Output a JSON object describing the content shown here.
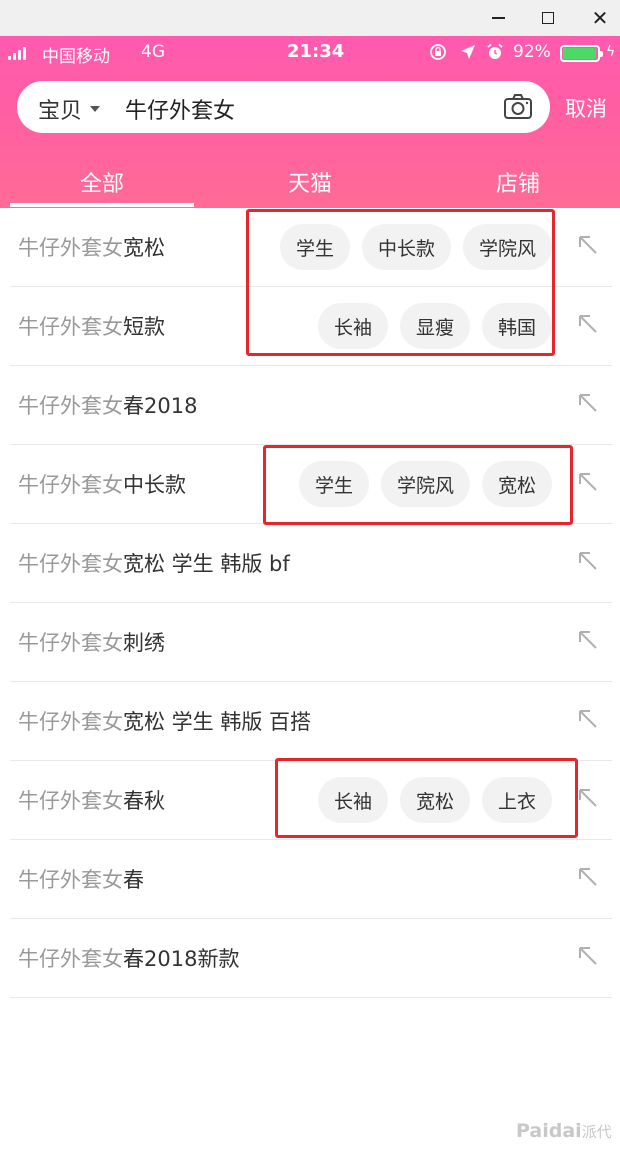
{
  "window": {
    "minimize": "minimize",
    "maximize": "maximize",
    "close": "close"
  },
  "status": {
    "carrier": "中国移动",
    "network": "4G",
    "time": "21:34",
    "battery": "92%",
    "battery_level": 0.92
  },
  "search": {
    "scope": "宝贝",
    "query": "牛仔外套女",
    "cancel": "取消"
  },
  "tabs": [
    {
      "label": "全部",
      "active": true
    },
    {
      "label": "天猫",
      "active": false
    },
    {
      "label": "店铺",
      "active": false
    }
  ],
  "suggestions": [
    {
      "base": "牛仔外套女",
      "suffix": "宽松",
      "tags": [
        "学生",
        "中长款",
        "学院风"
      ]
    },
    {
      "base": "牛仔外套女",
      "suffix": "短款",
      "tags": [
        "长袖",
        "显瘦",
        "韩国"
      ]
    },
    {
      "base": "牛仔外套女",
      "suffix": "春2018",
      "tags": []
    },
    {
      "base": "牛仔外套女",
      "suffix": "中长款",
      "tags": [
        "学生",
        "学院风",
        "宽松"
      ]
    },
    {
      "base": "牛仔外套女",
      "suffix": "宽松 学生 韩版 bf",
      "tags": []
    },
    {
      "base": "牛仔外套女",
      "suffix": "刺绣",
      "tags": []
    },
    {
      "base": "牛仔外套女",
      "suffix": "宽松 学生 韩版 百搭",
      "tags": []
    },
    {
      "base": "牛仔外套女",
      "suffix": "春秋",
      "tags": [
        "长袖",
        "宽松",
        "上衣"
      ]
    },
    {
      "base": "牛仔外套女",
      "suffix": "春",
      "tags": []
    },
    {
      "base": "牛仔外套女",
      "suffix": "春2018新款",
      "tags": []
    }
  ],
  "watermark": {
    "latin": "Paidai",
    "cjk": "派代"
  },
  "colors": {
    "header_top": "#ff5ab0",
    "header_bottom": "#ff6b95",
    "highlight": "#e8252b",
    "battery": "#4cd964"
  },
  "icons": [
    "camera-icon",
    "arrow-up-left-icon",
    "alarm-icon",
    "location-icon",
    "lock-rotation-icon"
  ]
}
